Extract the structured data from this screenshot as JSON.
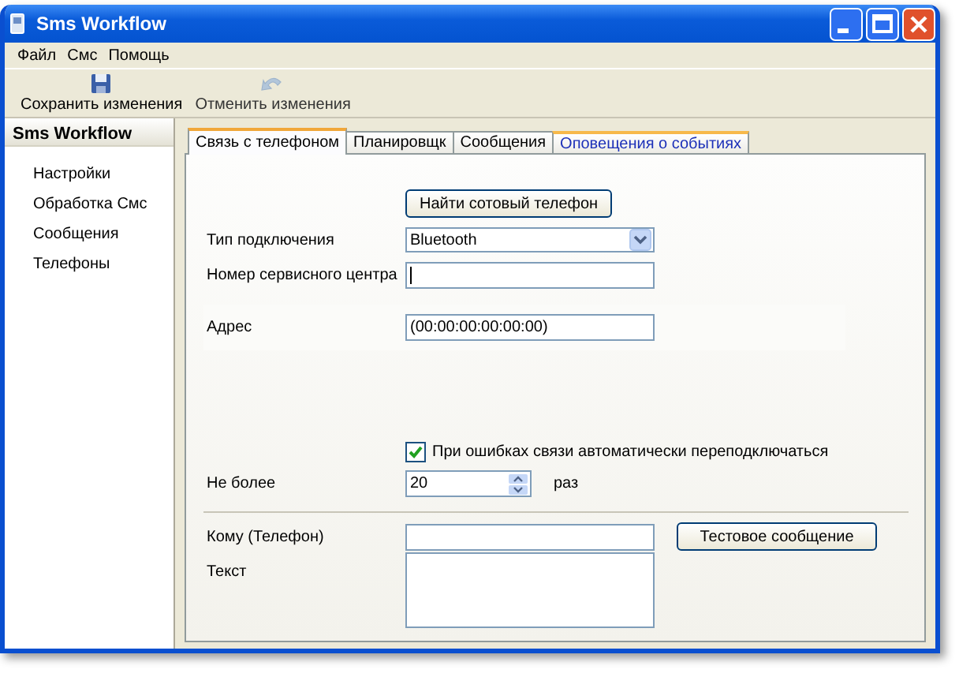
{
  "window": {
    "title": "Sms Workflow"
  },
  "menu": [
    "Файл",
    "Смс",
    "Помощь"
  ],
  "toolbar": [
    {
      "label": "Сохранить изменения",
      "kind": "save",
      "disabled": false
    },
    {
      "label": "Отменить изменения",
      "kind": "undo",
      "disabled": true
    }
  ],
  "sidebar": {
    "title": "Sms Workflow",
    "items": [
      "Настройки",
      "Обработка Смс",
      "Сообщения",
      "Телефоны"
    ]
  },
  "tabs": [
    {
      "label": "Связь с телефоном",
      "selected": true,
      "hover": false
    },
    {
      "label": "Планировщк",
      "selected": false,
      "hover": false
    },
    {
      "label": "Сообщения",
      "selected": false,
      "hover": false
    },
    {
      "label": "Оповещения о событиях",
      "selected": false,
      "hover": true
    }
  ],
  "form": {
    "find_button": "Найти сотовый телефон",
    "connection_type": {
      "label": "Тип подключения",
      "value": "Bluetooth"
    },
    "service_center": {
      "label": "Номер сервисного центра",
      "focused": true
    },
    "address": {
      "label": "Адрес",
      "value": "(00:00:00:00:00:00)"
    },
    "auto_reconnect": {
      "label": "При ошибках связи автоматически переподключаться",
      "checked": true
    },
    "max_retries": {
      "label": "Не более",
      "value": "20",
      "unit": "раз"
    },
    "recipient": {
      "label": "Кому (Телефон)"
    },
    "test_button": "Тестовое сообщение",
    "text": {
      "label": "Текст"
    }
  }
}
